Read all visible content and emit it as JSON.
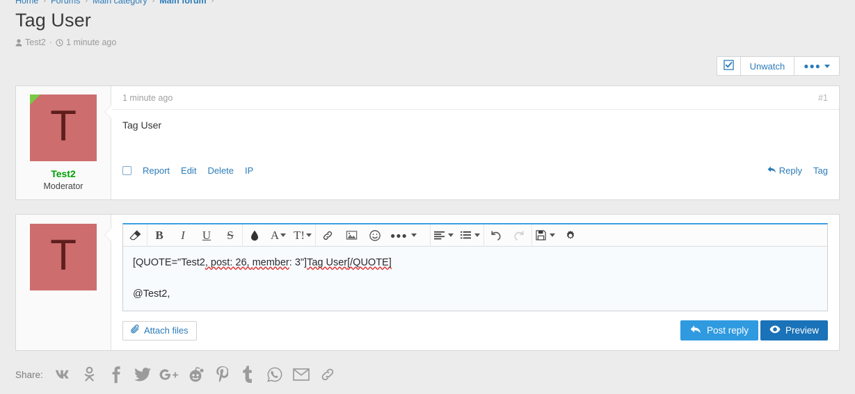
{
  "breadcrumb": {
    "items": [
      {
        "label": "Home",
        "current": false
      },
      {
        "label": "Forums",
        "current": false
      },
      {
        "label": "Main category",
        "current": false
      },
      {
        "label": "Main forum",
        "current": true
      }
    ],
    "separator": "›"
  },
  "page": {
    "title": "Tag User",
    "author": "Test2",
    "dot": "·",
    "time": "1 minute ago"
  },
  "actions": {
    "watch_icon": "checkbox-checked-icon",
    "unwatch_label": "Unwatch",
    "more_label": "•••"
  },
  "post": {
    "avatar_letter": "T",
    "avatar_color": "#cd6d6d",
    "avatar_letter_color": "#5e1e1e",
    "online_color": "#7ac943",
    "username": "Test2",
    "username_color": "#00a000",
    "user_title": "Moderator",
    "time": "1 minute ago",
    "permalink": "#1",
    "content": "Tag User",
    "footer_left": [
      {
        "label": "Report"
      },
      {
        "label": "Edit"
      },
      {
        "label": "Delete"
      },
      {
        "label": "IP"
      }
    ],
    "footer_right": [
      {
        "label": "Reply",
        "icon": "reply-arrow-icon"
      },
      {
        "label": "Tag",
        "icon": ""
      }
    ]
  },
  "reply": {
    "avatar_letter": "T",
    "toolbar": [
      {
        "name": "remove-formatting-icon",
        "glyph": "eraser",
        "caret": false
      },
      {
        "sep": true
      },
      {
        "name": "bold-icon",
        "glyph": "B",
        "caret": false
      },
      {
        "name": "italic-icon",
        "glyph": "I",
        "caret": false
      },
      {
        "name": "underline-icon",
        "glyph": "U",
        "caret": false
      },
      {
        "name": "strikethrough-icon",
        "glyph": "S",
        "caret": false
      },
      {
        "sep": true
      },
      {
        "name": "text-color-icon",
        "glyph": "droplet",
        "caret": false
      },
      {
        "name": "font-family-icon",
        "glyph": "A",
        "caret": true
      },
      {
        "name": "font-size-icon",
        "glyph": "T!",
        "caret": true
      },
      {
        "sep": true
      },
      {
        "name": "insert-link-icon",
        "glyph": "link",
        "caret": false
      },
      {
        "name": "insert-image-icon",
        "glyph": "image",
        "caret": false
      },
      {
        "name": "insert-emoji-icon",
        "glyph": "smiley",
        "caret": false
      },
      {
        "name": "more-options-icon",
        "glyph": "dots",
        "caret": true
      },
      {
        "sep": true
      },
      {
        "name": "text-align-icon",
        "glyph": "align",
        "caret": true
      },
      {
        "name": "list-icon",
        "glyph": "list",
        "caret": true
      },
      {
        "sep": true
      },
      {
        "name": "undo-icon",
        "glyph": "undo",
        "caret": false
      },
      {
        "name": "redo-icon",
        "glyph": "redo",
        "caret": false,
        "disabled": true
      },
      {
        "sep": true
      },
      {
        "name": "draft-icon",
        "glyph": "save",
        "caret": true
      },
      {
        "name": "settings-gear-icon",
        "glyph": "gear",
        "caret": false
      }
    ],
    "content_line1_a": "[QUOTE=\"Test2",
    "content_line1_b": ", post: 26, ",
    "content_line1_c": "member",
    "content_line1_d": ": 3\"]",
    "content_line1_e": "Tag User",
    "content_line1_f": "[/QUOTE]",
    "content_line2": "@Test2,",
    "attach_label": "Attach files",
    "post_label": "Post reply",
    "preview_label": "Preview",
    "post_color": "#2f9ae0",
    "preview_color": "#1a72b8"
  },
  "share": {
    "label": "Share:",
    "items": [
      {
        "name": "vk-icon",
        "glyph": "VK"
      },
      {
        "name": "odnoklassniki-icon",
        "glyph": "OK"
      },
      {
        "name": "facebook-icon",
        "glyph": "f"
      },
      {
        "name": "twitter-icon",
        "glyph": "tw"
      },
      {
        "name": "google-plus-icon",
        "glyph": "G+"
      },
      {
        "name": "reddit-icon",
        "glyph": "rd"
      },
      {
        "name": "pinterest-icon",
        "glyph": "P"
      },
      {
        "name": "tumblr-icon",
        "glyph": "t"
      },
      {
        "name": "whatsapp-icon",
        "glyph": "wa"
      },
      {
        "name": "email-icon",
        "glyph": "mail"
      },
      {
        "name": "link-icon",
        "glyph": "link"
      }
    ]
  }
}
